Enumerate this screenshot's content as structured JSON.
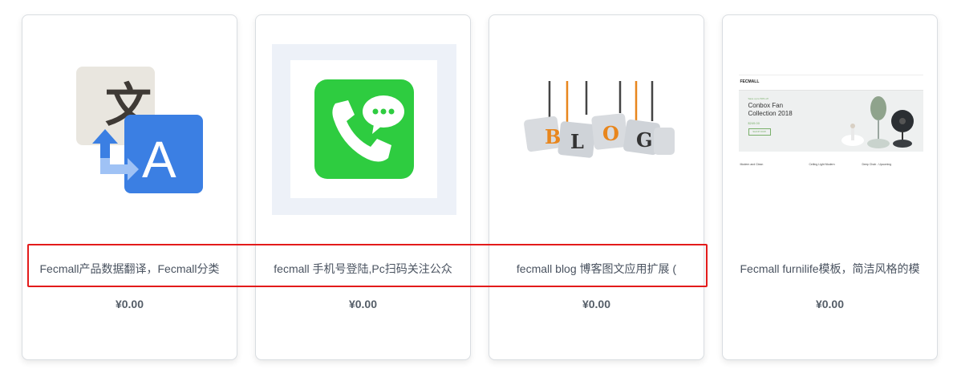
{
  "products": [
    {
      "icon": "translate-icon",
      "title": "Fecmall产品数据翻译，Fecmall分类",
      "price": "¥0.00"
    },
    {
      "icon": "wechat-phone-icon",
      "title": "fecmall 手机号登陆,Pc扫码关注公众",
      "price": "¥0.00"
    },
    {
      "icon": "blog-puzzle-icon",
      "title": "fecmall blog 博客图文应用扩展 (",
      "price": "¥0.00",
      "thumb_text": "BLOG"
    },
    {
      "icon": "furnilife-template-preview",
      "title": "Fecmall furnilife模板，简洁风格的模",
      "price": "¥0.00",
      "thumb_text": {
        "logo": "FECMALL",
        "promo_small": "Save up to 50% off",
        "hero_title": "Conbox Fan Collection 2018",
        "hero_price": "$249.00",
        "shop_now": "SHOP NOW",
        "item1": "Modern and Clean",
        "item2": "Ceiling Light Modern",
        "item3": "Deep Chair - Upcoming"
      }
    }
  ],
  "colors": {
    "highlight": "#e31b1b",
    "translate_blue": "#3b7fe3",
    "wechat_green": "#2ecc40",
    "blog_orange": "#e8861d"
  }
}
